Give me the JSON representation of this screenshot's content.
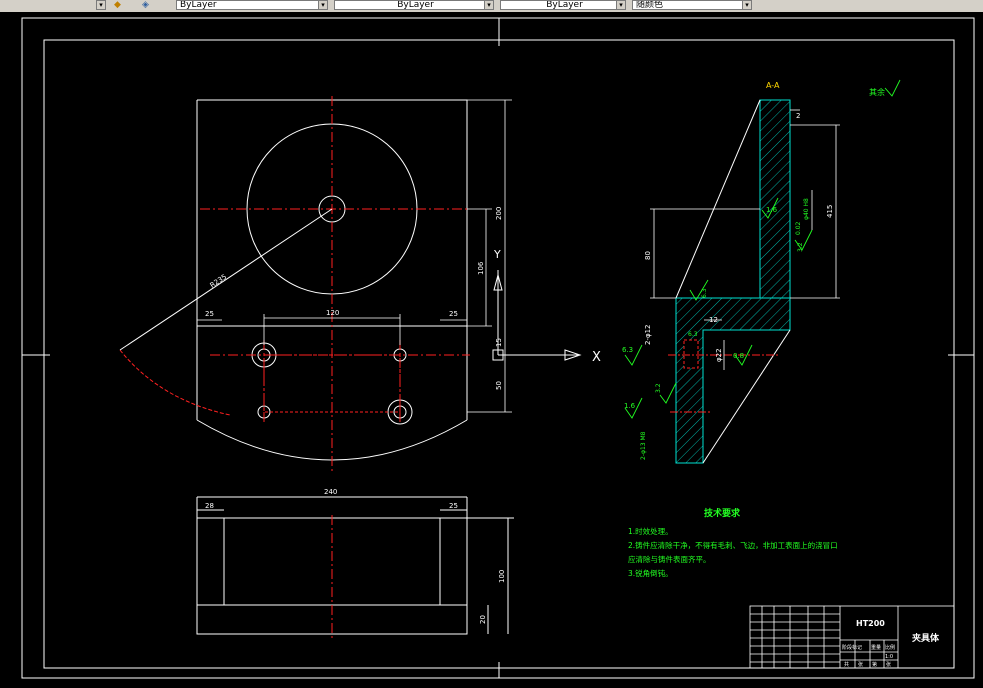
{
  "toolbar": {
    "layer_combo_1": "ByLayer",
    "layer_combo_2": "ByLayer",
    "layer_combo_3": "ByLayer",
    "color_combo": "随颜色",
    "dropdown_glyph": "▾",
    "icons": [
      "layer-match-icon",
      "layer-previous-icon"
    ]
  },
  "drawing": {
    "section_label": "A-A",
    "roughness_label": "其余",
    "dims": {
      "top_width": "120",
      "left_25": "25",
      "right_25": "25",
      "height_200": "200",
      "height_106": "106",
      "dim_15": "15",
      "dim_50": "50",
      "radius": "R235",
      "bottom_width": "240",
      "bottom_left_28": "28",
      "bottom_right_25": "25",
      "bottom_height": "100",
      "bottom_small": "20",
      "sec_2": "2",
      "sec_415": "415",
      "sec_80": "80",
      "sec_12": "12",
      "sec_phi22": "φ22",
      "sec_2phi12": "2-φ12",
      "sec_thread": "2-φ13 M8",
      "sec_phi40": "φ40 H8",
      "sec_tol": "0.02"
    },
    "roughness": {
      "r1": "1.6",
      "r2": "3.2",
      "r3": "6.3",
      "r4": "6.3",
      "r5": "0.8",
      "r6": "6.3",
      "r7": "3.2",
      "r8": "1.6"
    },
    "axis_x": "X",
    "axis_y": "Y"
  },
  "notes": {
    "title": "技术要求",
    "lines": [
      "1.时效处理。",
      "2.铸件应清除干净，不得有毛刺、飞边，非加工表面上的浇冒口",
      "应清除与铸件表面齐平。",
      "3.锐角倒钝。"
    ]
  },
  "title_block": {
    "material": "HT200",
    "name": "夹具体",
    "scale_cells": [
      "阶段标记",
      "重量",
      "比例"
    ],
    "scale_value": "1:0",
    "bottom_cells": [
      "共",
      "张",
      "第",
      "张"
    ]
  }
}
